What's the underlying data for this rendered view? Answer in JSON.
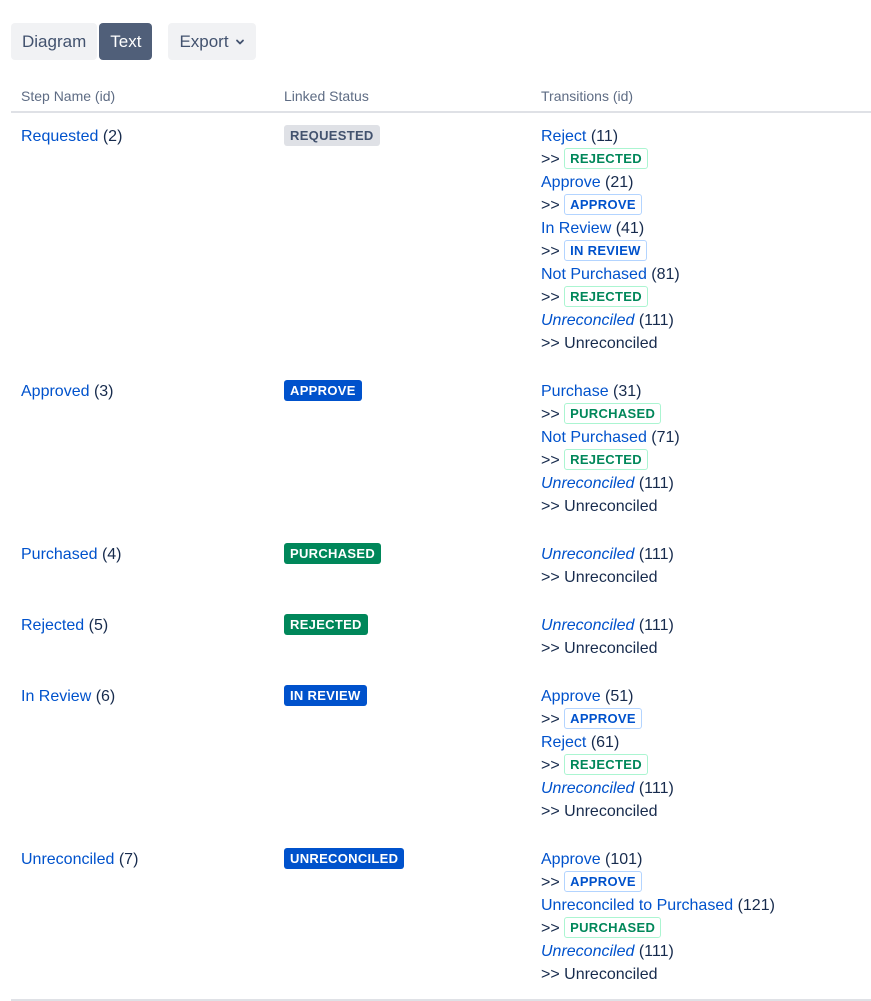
{
  "toolbar": {
    "diagram_label": "Diagram",
    "text_label": "Text",
    "export_label": "Export",
    "active": "text"
  },
  "table": {
    "headers": [
      "Step Name (id)",
      "Linked Status",
      "Transitions (id)"
    ],
    "arrow": ">>",
    "rows": [
      {
        "step_name": "Requested",
        "step_id": "(2)",
        "status": "REQUESTED",
        "status_color": "grey",
        "transitions": [
          {
            "name": "Reject",
            "id": "(11)",
            "italic": false,
            "target": "REJECTED",
            "target_style": "green"
          },
          {
            "name": "Approve",
            "id": "(21)",
            "italic": false,
            "target": "APPROVE",
            "target_style": "blue"
          },
          {
            "name": "In Review",
            "id": "(41)",
            "italic": false,
            "target": "IN REVIEW",
            "target_style": "blue"
          },
          {
            "name": "Not Purchased",
            "id": "(81)",
            "italic": false,
            "target": "REJECTED",
            "target_style": "green"
          },
          {
            "name": "Unreconciled",
            "id": "(111)",
            "italic": true,
            "target": "Unreconciled",
            "target_style": "plain"
          }
        ]
      },
      {
        "step_name": "Approved",
        "step_id": "(3)",
        "status": "APPROVE",
        "status_color": "blue",
        "transitions": [
          {
            "name": "Purchase",
            "id": "(31)",
            "italic": false,
            "target": "PURCHASED",
            "target_style": "green"
          },
          {
            "name": "Not Purchased",
            "id": "(71)",
            "italic": false,
            "target": "REJECTED",
            "target_style": "green"
          },
          {
            "name": "Unreconciled",
            "id": "(111)",
            "italic": true,
            "target": "Unreconciled",
            "target_style": "plain"
          }
        ]
      },
      {
        "step_name": "Purchased",
        "step_id": "(4)",
        "status": "PURCHASED",
        "status_color": "green",
        "transitions": [
          {
            "name": "Unreconciled",
            "id": "(111)",
            "italic": true,
            "target": "Unreconciled",
            "target_style": "plain"
          }
        ]
      },
      {
        "step_name": "Rejected",
        "step_id": "(5)",
        "status": "REJECTED",
        "status_color": "green",
        "transitions": [
          {
            "name": "Unreconciled",
            "id": "(111)",
            "italic": true,
            "target": "Unreconciled",
            "target_style": "plain"
          }
        ]
      },
      {
        "step_name": "In Review",
        "step_id": "(6)",
        "status": "IN REVIEW",
        "status_color": "blue",
        "transitions": [
          {
            "name": "Approve",
            "id": "(51)",
            "italic": false,
            "target": "APPROVE",
            "target_style": "blue"
          },
          {
            "name": "Reject",
            "id": "(61)",
            "italic": false,
            "target": "REJECTED",
            "target_style": "green"
          },
          {
            "name": "Unreconciled",
            "id": "(111)",
            "italic": true,
            "target": "Unreconciled",
            "target_style": "plain"
          }
        ]
      },
      {
        "step_name": "Unreconciled",
        "step_id": "(7)",
        "status": "UNRECONCILED",
        "status_color": "blue",
        "transitions": [
          {
            "name": "Approve",
            "id": "(101)",
            "italic": false,
            "target": "APPROVE",
            "target_style": "blue"
          },
          {
            "name": "Unreconciled to Purchased",
            "id": "(121)",
            "italic": false,
            "target": "PURCHASED",
            "target_style": "green"
          },
          {
            "name": "Unreconciled",
            "id": "(111)",
            "italic": true,
            "target": "Unreconciled",
            "target_style": "plain"
          }
        ]
      }
    ]
  },
  "icons": {
    "export_dropdown": "chevron-down-icon"
  }
}
